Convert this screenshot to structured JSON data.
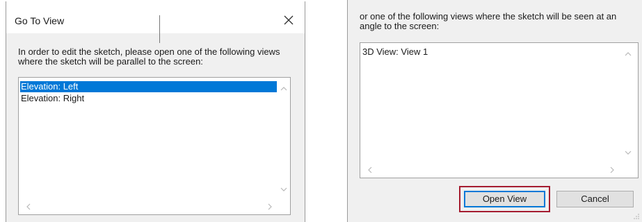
{
  "left_dialog": {
    "title": "Go To View",
    "prompt": "In order to edit the sketch, please open one of the following views where the sketch will be parallel to the screen:",
    "items": [
      {
        "label": "Elevation: Left",
        "selected": true
      },
      {
        "label": "Elevation: Right",
        "selected": false
      }
    ],
    "close_icon": "close-icon",
    "scroll_icons": [
      "chevron-up-icon",
      "chevron-down-icon",
      "chevron-left-icon",
      "chevron-right-icon"
    ]
  },
  "right_dialog": {
    "prompt": "or one of the following views where the sketch will be seen at an angle to the screen:",
    "items": [
      {
        "label": "3D View: View 1",
        "selected": false
      }
    ],
    "open_view_label": "Open View",
    "cancel_label": "Cancel",
    "highlight_color": "#a51c30",
    "selection_color": "#0078d7"
  }
}
